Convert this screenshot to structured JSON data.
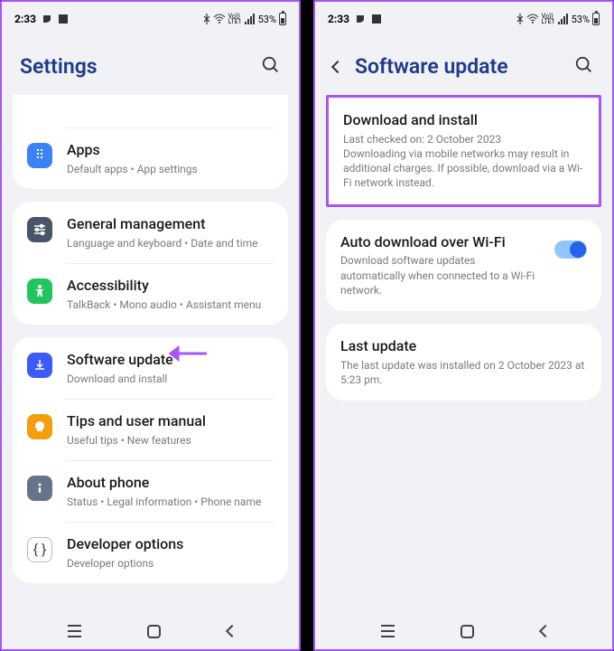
{
  "status": {
    "time": "2:33",
    "battery": "53%",
    "network": "Vo))\nLTE ll"
  },
  "left": {
    "header_title": "Settings",
    "items": [
      {
        "title": "Apps",
        "sub": "Default apps  •  App settings"
      },
      {
        "title": "General management",
        "sub": "Language and keyboard  •  Date and time"
      },
      {
        "title": "Accessibility",
        "sub": "TalkBack  •  Mono audio  •  Assistant menu"
      },
      {
        "title": "Software update",
        "sub": "Download and install"
      },
      {
        "title": "Tips and user manual",
        "sub": "Useful tips  •  New features"
      },
      {
        "title": "About phone",
        "sub": "Status  •  Legal information  •  Phone name"
      },
      {
        "title": "Developer options",
        "sub": "Developer options"
      }
    ]
  },
  "right": {
    "header_title": "Software update",
    "download": {
      "title": "Download and install",
      "sub": "Last checked on: 2 October 2023\nDownloading via mobile networks may result in additional charges. If possible, download via a Wi-Fi network instead."
    },
    "auto": {
      "title": "Auto download over Wi-Fi",
      "sub": "Download software updates automatically when connected to a Wi-Fi network."
    },
    "last": {
      "title": "Last update",
      "sub": "The last update was installed on 2 October 2023 at 5:23 pm."
    }
  }
}
